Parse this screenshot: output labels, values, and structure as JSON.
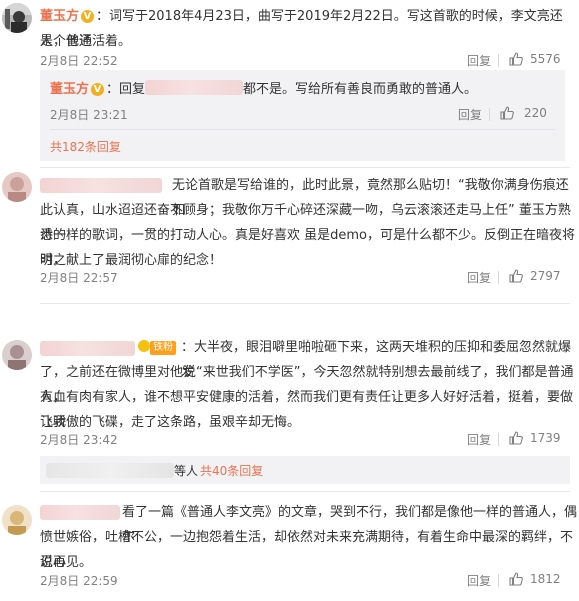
{
  "comments": [
    {
      "author": "董玉方",
      "line1": "：词写于2018年4月23日，曲写于2019年2月22日。写这首歌的时候，李文亮还是个普通",
      "line2": "人，他还活着。",
      "time": "2月8日 22:52",
      "reply_label": "回复",
      "like_count": "5576",
      "reply": {
        "author": "董玉方",
        "prefix": "：回复",
        "suffix": "都不是。写给所有善良而勇敢的普通人。",
        "time": "2月8日 23:21",
        "reply_label": "回复",
        "like_count": "220"
      },
      "more_replies": "共182条回复"
    },
    {
      "lines": [
        "无论首歌是写给谁的，此时此景，竟然那么贴切！“我敬你满身伤痕还如",
        "此认真，山水迢迢还奋不顾身；我敬你万千心碎还深藏一吻，乌云滚滚还走马上任” 董玉方熟悉的",
        "诗一样的歌词，一贯的打动人心。真是好喜欢 虽是demo，可是什么都不少。反倒正在暗夜将明之",
        "时，献上了最润彻心扉的纪念！"
      ],
      "time": "2月8日 22:57",
      "reply_label": "回复",
      "like_count": "2797"
    },
    {
      "fan_badge": "铁粉",
      "lines": [
        "：大半夜，眼泪噼里啪啦砸下来，这两天堆积的压抑和委屈忽然就爆发",
        "了，之前还在微博里对他说“来世我们不学医”，今天忽然就特别想去最前线了，我们都是普通人，",
        "有血有肉有家人，谁不想平安健康的活着，然而我们更有责任让更多人好好活着，挺着，要做让我",
        "飞骄傲的飞碟，走了这条路，虽艰辛却无悔。"
      ],
      "time": "2月8日 23:42",
      "reply_label": "回复",
      "like_count": "1739",
      "replies_tail": "等人",
      "more_replies": "共40条回复"
    },
    {
      "lines": [
        "看了一篇《普通人李文亮》的文章，哭到不行，我们都是像他一样的普通人，偶尔",
        "愤世嫉俗，吐槽不公，一边抱怨着生活，却依然对未来充满期待，有着生命中最深的羁绊，不忍心",
        "说再见。"
      ],
      "time": "2月8日 22:59",
      "reply_label": "回复",
      "like_count": "1812"
    }
  ],
  "icons": {
    "like": "thumbs-up-icon",
    "verified": "verified-v-icon"
  },
  "colors": {
    "name": "#eb7350",
    "text": "#333333",
    "meta": "#808080",
    "reply_bg": "#f2f2f5",
    "badge_v": "#f2b01e",
    "badge_fan": "#ff9f1a"
  }
}
